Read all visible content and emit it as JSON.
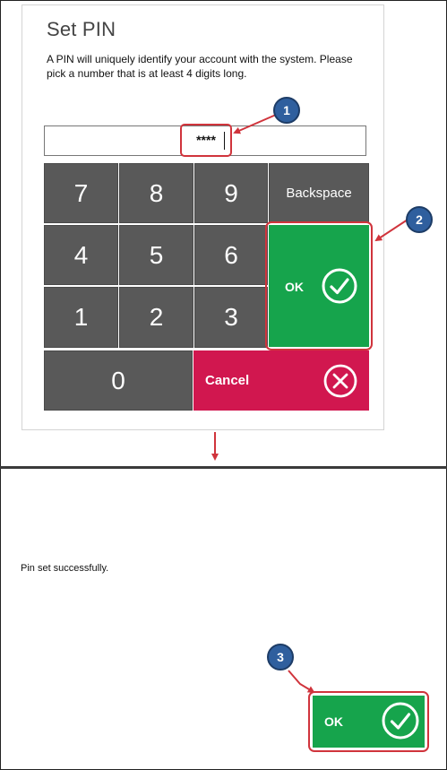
{
  "dialog": {
    "title": "Set PIN",
    "description": "A PIN will uniquely identify your account with the system. Please pick a number that is at least 4 digits long.",
    "pin_mask": "****"
  },
  "keypad": {
    "k7": "7",
    "k8": "8",
    "k9": "9",
    "backspace": "Backspace",
    "k4": "4",
    "k5": "5",
    "k6": "6",
    "k1": "1",
    "k2": "2",
    "k3": "3",
    "k0": "0",
    "ok": "OK",
    "cancel": "Cancel"
  },
  "colors": {
    "key": "#595959",
    "ok": "#16a44c",
    "cancel": "#d1174f",
    "highlight": "#d0343c",
    "badge": "#2f5f9e"
  },
  "callouts": {
    "one": "1",
    "two": "2",
    "three": "3"
  },
  "confirmation": {
    "message": "Pin set successfully.",
    "ok": "OK"
  }
}
